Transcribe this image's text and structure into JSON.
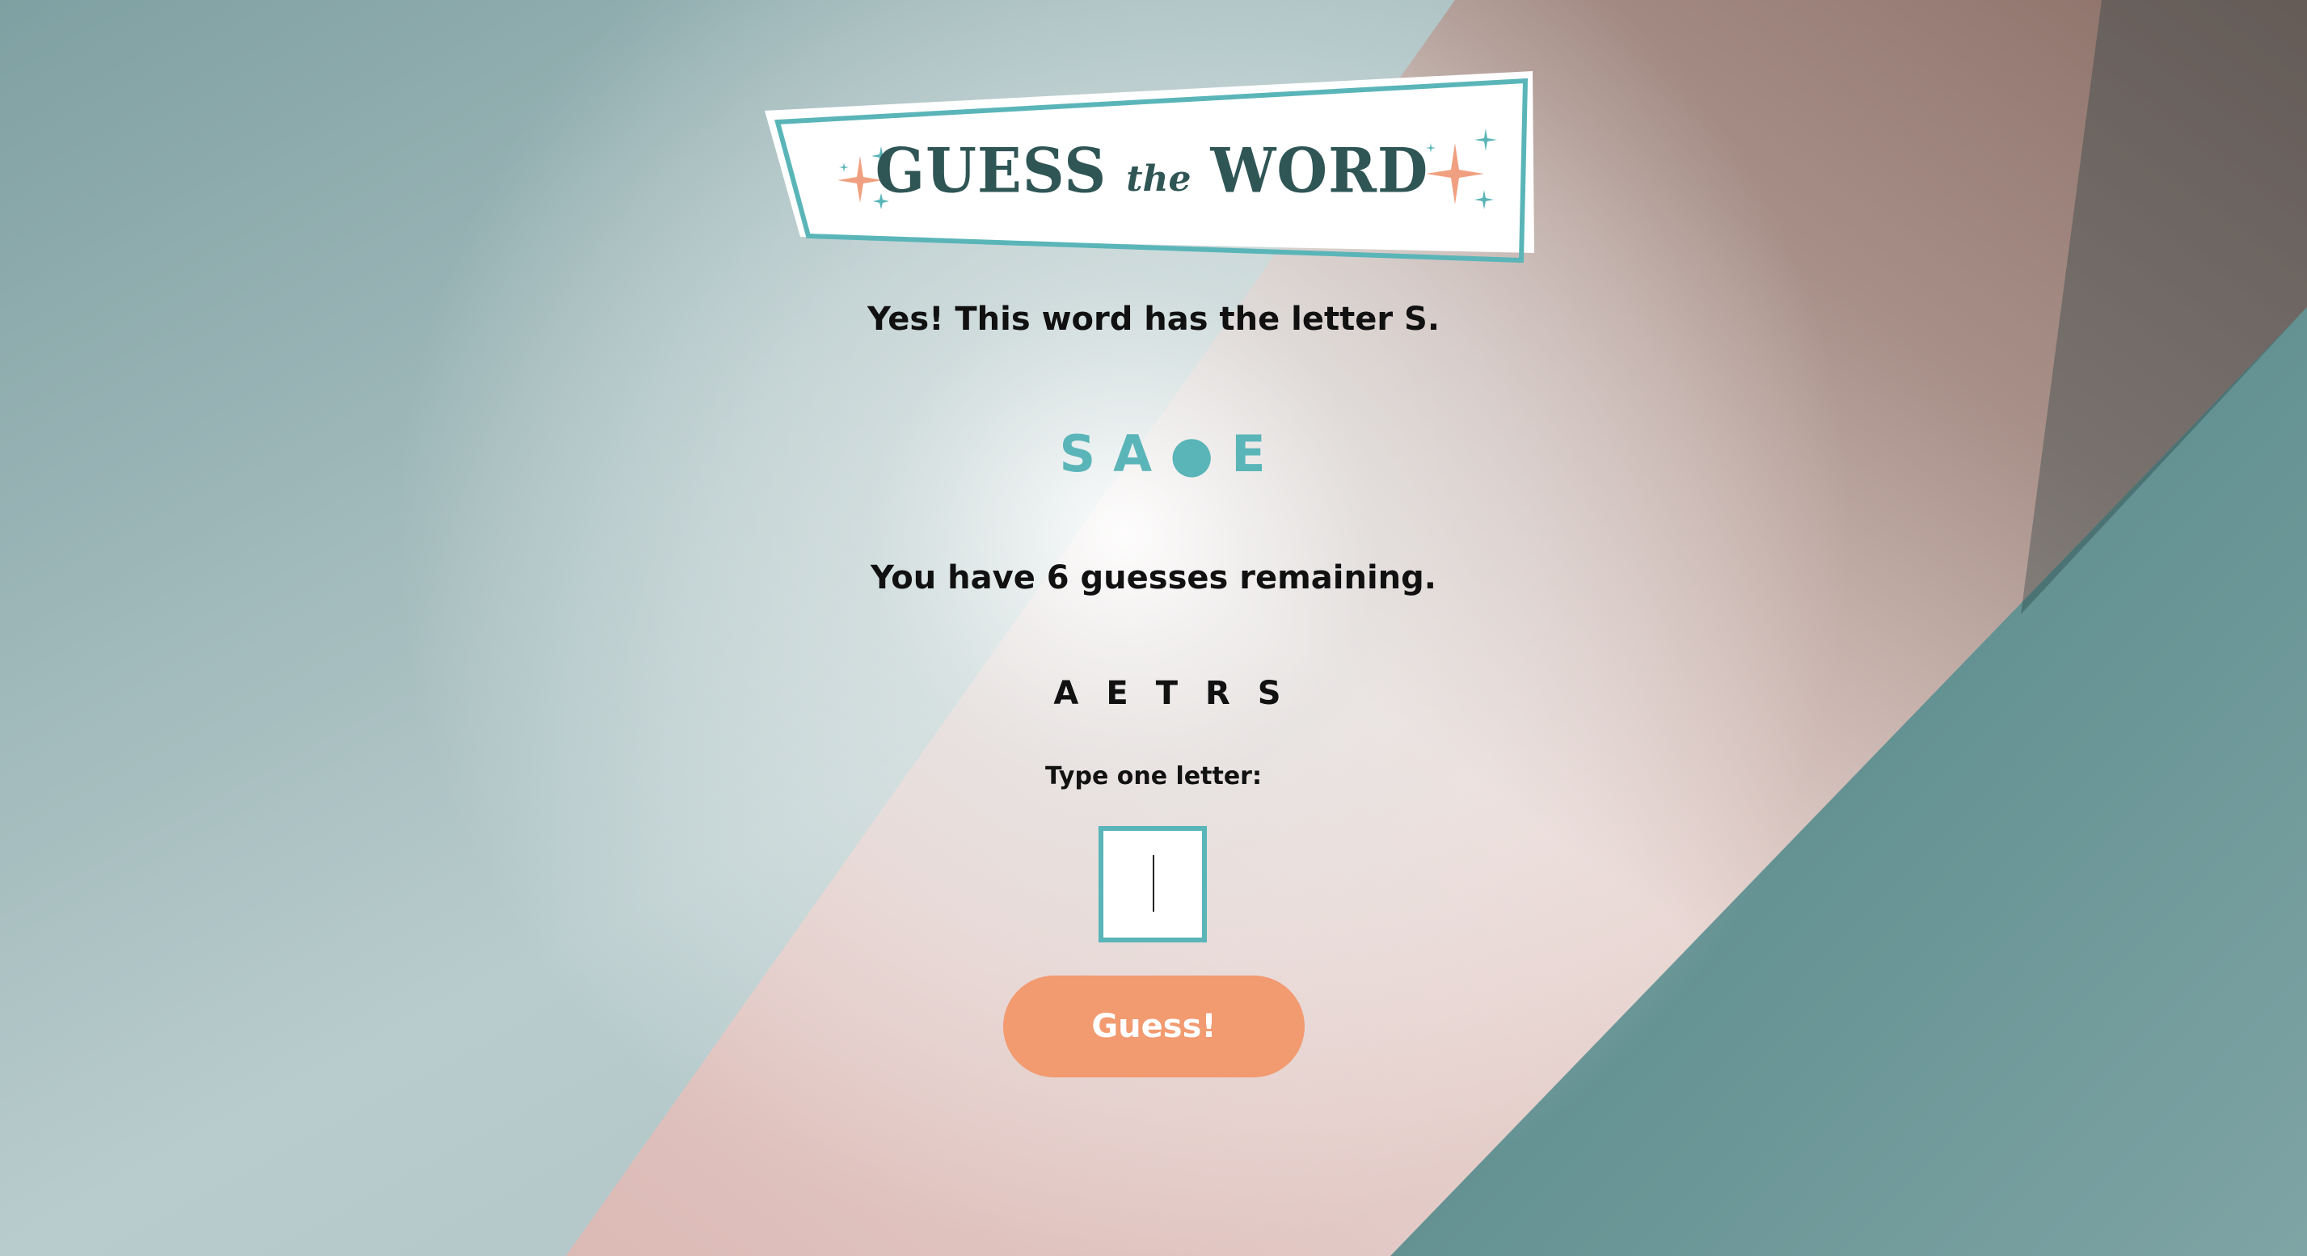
{
  "header": {
    "title_part1": "GUESS",
    "title_part2": "the",
    "title_part3": "WORD",
    "accent_color": "#5ab5b8",
    "sparkle_color": "#f0a080",
    "title_color": "#2f5555"
  },
  "game": {
    "message": "Yes! This word has the letter S.",
    "word_progress": "SA●E",
    "remaining": "You have 6 guesses remaining.",
    "guessed_letters": "AETRS"
  },
  "form": {
    "label": "Type one letter:",
    "input_value": "",
    "button_label": "Guess!",
    "button_color": "#f29a70"
  }
}
